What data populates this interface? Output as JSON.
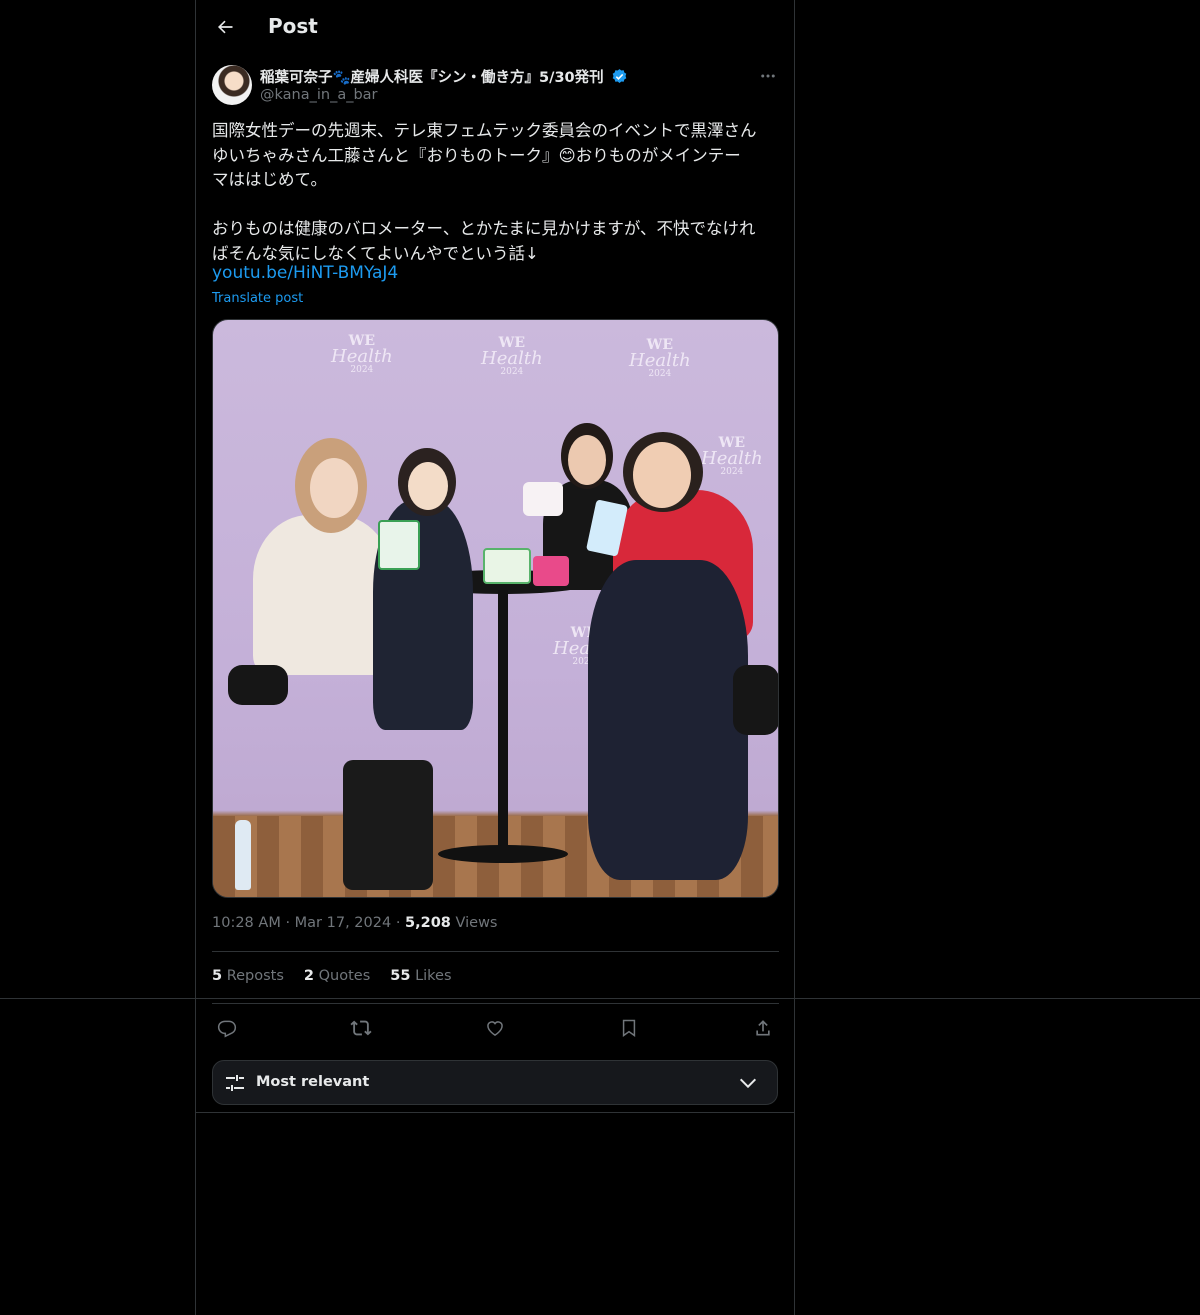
{
  "header": {
    "title": "Post"
  },
  "author": {
    "display_name": "稲葉可奈子🐾産婦人科医『シン・働き方』5/30発刊",
    "handle": "@kana_in_a_bar",
    "verified": true
  },
  "post": {
    "text": "国際女性デーの先週末、テレ東フェムテック委員会のイベントで黒澤さん\nゆいちゃみさん工藤さんと『おりものトーク』😊おりものがメインテー\nマははじめて。\n\nおりものは健康のバロメーター、とかたまに見かけますが、不快でなけれ\nばそんな気にしなくてよいんやでという話↓",
    "link": "youtu.be/HiNT-BMYaJ4",
    "translate_label": "Translate post",
    "image": {
      "backdrop_logo": {
        "line1": "WE",
        "line2": "Health",
        "line3": "2024"
      }
    }
  },
  "meta": {
    "time": "10:28 AM",
    "date": "Mar 17, 2024",
    "views_count": "5,208",
    "views_label": "Views"
  },
  "stats": {
    "reposts_count": "5",
    "reposts_label": "Reposts",
    "quotes_count": "2",
    "quotes_label": "Quotes",
    "likes_count": "55",
    "likes_label": "Likes"
  },
  "actions": [
    "reply-icon",
    "repost-icon",
    "like-icon",
    "bookmark-icon",
    "share-icon"
  ],
  "sort": {
    "label": "Most relevant"
  },
  "colors": {
    "background": "#000000",
    "border": "#2f3336",
    "text_primary": "#e7e9ea",
    "text_secondary": "#71767b",
    "accent": "#1d9bf0"
  }
}
